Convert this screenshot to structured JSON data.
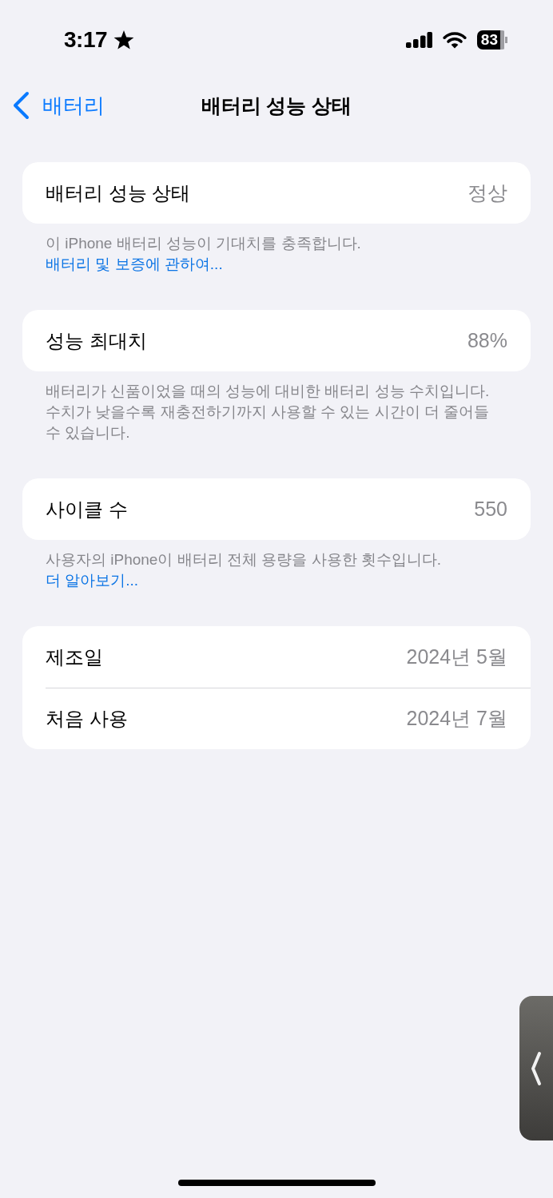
{
  "status_bar": {
    "time": "3:17",
    "battery": "83"
  },
  "nav": {
    "back": "배터리",
    "title": "배터리 성능 상태"
  },
  "sections": [
    {
      "rows": [
        {
          "label": "배터리 성능 상태",
          "value": "정상"
        }
      ],
      "footer": {
        "text": "이 iPhone 배터리 성능이 기대치를 충족합니다.",
        "link": "배터리 및 보증에 관하여..."
      }
    },
    {
      "rows": [
        {
          "label": "성능 최대치",
          "value": "88%"
        }
      ],
      "footer": {
        "text": "배터리가 신품이었을 때의 성능에 대비한 배터리 성능 수치입니다. 수치가 낮을수록 재충전하기까지 사용할 수 있는 시간이 더 줄어들 수 있습니다."
      }
    },
    {
      "rows": [
        {
          "label": "사이클 수",
          "value": "550"
        }
      ],
      "footer": {
        "text": "사용자의 iPhone이 배터리 전체 용량을 사용한 횟수입니다.",
        "link": "더 알아보기..."
      }
    },
    {
      "rows": [
        {
          "label": "제조일",
          "value": "2024년 5월"
        },
        {
          "label": "처음 사용",
          "value": "2024년 7월"
        }
      ]
    }
  ]
}
